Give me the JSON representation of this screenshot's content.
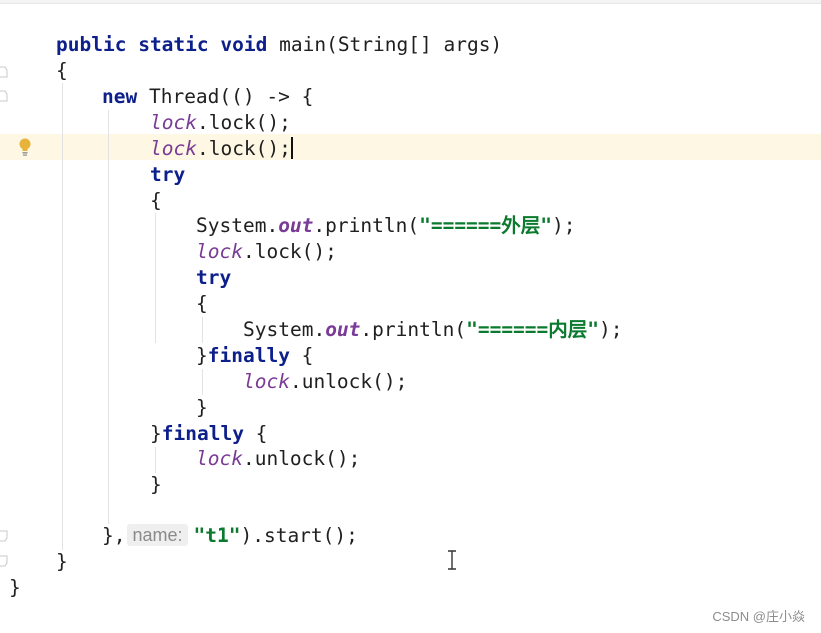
{
  "editor": {
    "lines": {
      "l1": {
        "public": "public",
        "static": "static",
        "void": "void",
        "rest": " main(String[] args)"
      },
      "l2": {
        "text": "{"
      },
      "l3": {
        "new": "new",
        "rest": " Thread(() -> {"
      },
      "l4": {
        "lock": "lock",
        "rest": ".lock();"
      },
      "l5": {
        "lock": "lock",
        "rest": ".lock();"
      },
      "l6": {
        "try": "try"
      },
      "l7": {
        "text": "{"
      },
      "l8": {
        "system": "System.",
        "out": "out",
        "println": ".println(",
        "str": "\"======外层\"",
        "end": ");"
      },
      "l9": {
        "lock": "lock",
        "rest": ".lock();"
      },
      "l10": {
        "try": "try"
      },
      "l11": {
        "text": "{"
      },
      "l12": {
        "system": "System.",
        "out": "out",
        "println": ".println(",
        "str": "\"======内层\"",
        "end": ");"
      },
      "l13": {
        "brace": "}",
        "finally": "finally",
        "rest": " {"
      },
      "l14": {
        "lock": "lock",
        "rest": ".unlock();"
      },
      "l15": {
        "text": "}"
      },
      "l16": {
        "brace": "}",
        "finally": "finally",
        "rest": " {"
      },
      "l17": {
        "lock": "lock",
        "rest": ".unlock();"
      },
      "l18": {
        "text": "}"
      },
      "l19": {
        "prefix": "},",
        "hint": "name:",
        "str": "\"t1\"",
        "rest": ").start();"
      },
      "l20": {
        "text": "}"
      },
      "l21": {
        "text": "}"
      }
    },
    "colors": {
      "keyword": "#0d1f8a",
      "field": "#7a3b96",
      "string": "#0b7a2e",
      "current_line": "#fdf7e3",
      "bulb": "#e8b33a"
    },
    "icons": {
      "intention": "lightbulb-icon",
      "cursor": "text-ibeam-icon",
      "fold": "fold-marker-icon"
    }
  },
  "watermark": {
    "text": "CSDN @庄小焱"
  }
}
